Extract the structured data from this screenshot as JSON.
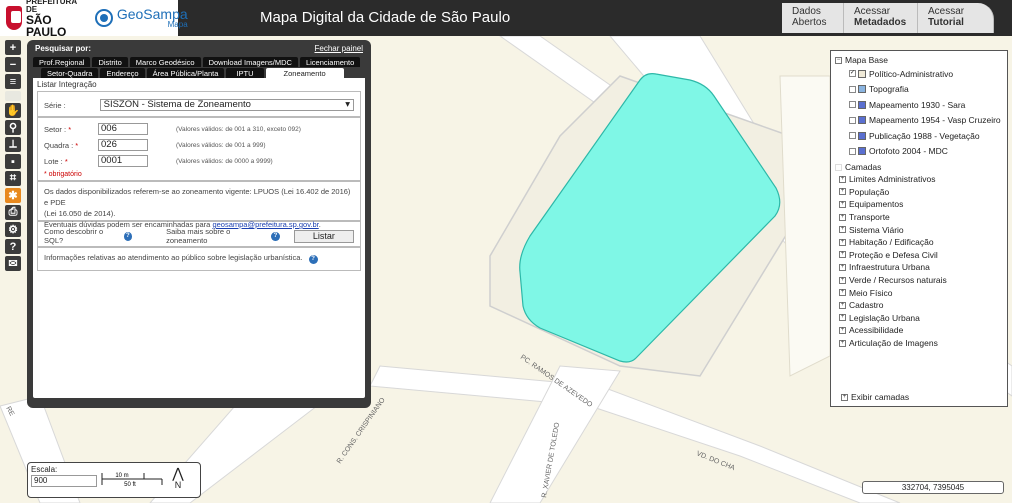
{
  "header": {
    "logo_prefeitura_line1": "PREFEITURA DE",
    "logo_prefeitura_line2": "SÃO PAULO",
    "logo_geosampa": "GeoSampa",
    "logo_geosampa_sub": "Mapa",
    "title": "Mapa Digital da Cidade de São Paulo",
    "tabs": [
      {
        "line1": "Dados",
        "line2": "Abertos"
      },
      {
        "line1": "Acessar",
        "line2": "Metadados"
      },
      {
        "line1": "Acessar",
        "line2": "Tutorial"
      }
    ]
  },
  "toolbar": {
    "buttons": [
      "+",
      "−"
    ]
  },
  "search_panel": {
    "title": "Pesquisar por:",
    "close_label": "Fechar painel",
    "tabs_row1": [
      "Prof.Regional",
      "Distrito",
      "Marco Geodésico",
      "Download Imagens/MDC",
      "Licenciamento"
    ],
    "tabs_row2": [
      "Setor-Quadra",
      "Endereço",
      "Área Pública/Planta",
      "IPTU",
      "Zoneamento"
    ],
    "active_tab": "Zoneamento",
    "legend": "Listar Integração",
    "serie_label": "Série :",
    "serie_value": "SISZON - Sistema de Zoneamento",
    "fields": [
      {
        "label": "Setor : ",
        "value": "006",
        "hint": "(Valores válidos: de 001 a 310, exceto 092)"
      },
      {
        "label": "Quadra : ",
        "value": "026",
        "hint": "(Valores válidos: de 001 a 999)"
      },
      {
        "label": "Lote : ",
        "value": "0001",
        "hint": "(Valores válidos: de 0000 a 9999)"
      }
    ],
    "required_mark": "*",
    "required_note": "* obrigatório",
    "info_line1": "Os dados disponibilizados referem-se ao zoneamento vigente: LPUOS (Lei 16.402 de 2016) e PDE",
    "info_line2": "(Lei 16.050 de 2014).",
    "info_line3": "Eventuais dúvidas podem ser encaminhadas para ",
    "email": "geosampa@prefeitura.sp.gov.br",
    "info_period": ".",
    "sql_help": "Como descobrir o SQL?",
    "zoneamento_help": "Saiba mais sobre o zoneamento",
    "listar_button": "Listar",
    "atendimento": "Informações relativas ao atendimento ao público sobre legislação urbanística."
  },
  "layers": {
    "base_title": "Mapa Base",
    "base_items": [
      {
        "label": "Político-Administrativo",
        "checked": true,
        "color": "#f0ead8"
      },
      {
        "label": "Topografia",
        "checked": false,
        "color": "#8ab4e0"
      },
      {
        "label": "Mapeamento 1930 - Sara",
        "checked": false,
        "color": "#5a6fd0"
      },
      {
        "label": "Mapeamento 1954 - Vasp Cruzeiro",
        "checked": false,
        "color": "#5a6fd0"
      },
      {
        "label": "Publicação 1988 - Vegetação",
        "checked": false,
        "color": "#5a6fd0"
      },
      {
        "label": "Ortofoto 2004 - MDC",
        "checked": false,
        "color": "#5a6fd0"
      }
    ],
    "camadas_title": "Camadas",
    "camadas": [
      "Limites Administrativos",
      "População",
      "Equipamentos",
      "Transporte",
      "Sistema Viário",
      "Habitação / Edificação",
      "Proteção e Defesa Civil",
      "Infraestrutura Urbana",
      "Verde / Recursos naturais",
      "Meio Físico",
      "Cadastro",
      "Legislação Urbana",
      "Acessibilidade",
      "Articulação de Imagens"
    ],
    "exibir": "Exibir camadas"
  },
  "map": {
    "street_labels": [
      "PC. RAMOS DE AZEVEDO",
      "R. CONS. CRISPINIANO",
      "VD. DO CHA",
      "R. XAVIER DE TOLEDO",
      "RE"
    ],
    "highlight_color": "#7ff7e6"
  },
  "scale": {
    "label": "Escala:",
    "value": "900",
    "bar_top": "10 m",
    "bar_bottom": "50 ft",
    "north": "N"
  },
  "coords": "332704, 7395045"
}
